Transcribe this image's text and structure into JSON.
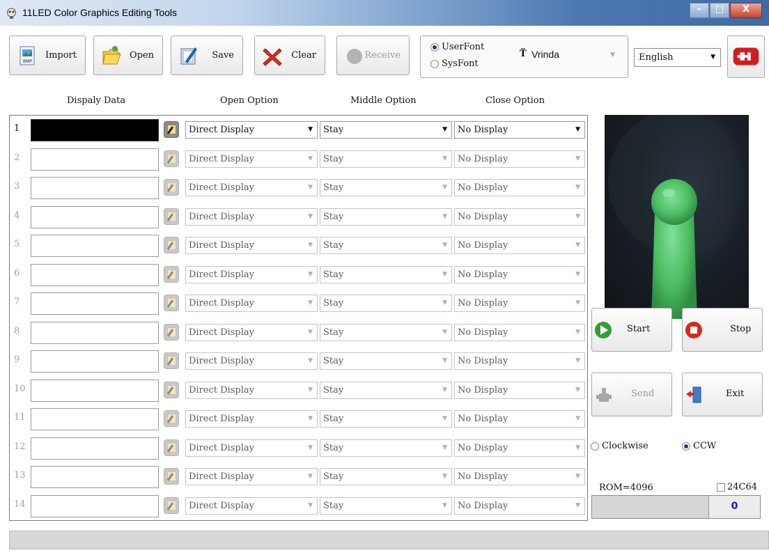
{
  "window": {
    "title": "11LED Color Graphics Editing Tools"
  },
  "toolbar": {
    "import_label": "Import",
    "open_label": "Open",
    "save_label": "Save",
    "clear_label": "Clear",
    "receive_label": "Receive"
  },
  "font": {
    "userfont_label": "UserFont",
    "sysfont_label": "SysFont",
    "selected_font": "Vrinda",
    "font_icon": "T̈"
  },
  "language": {
    "selected": "English"
  },
  "headers": {
    "display": "Dispaly Data",
    "open": "Open Option",
    "middle": "Middle Option",
    "close": "Close Option"
  },
  "rows": [
    {
      "num": "1",
      "open": "Direct Display",
      "middle": "Stay",
      "close": "No Display"
    },
    {
      "num": "2",
      "open": "Direct Display",
      "middle": "Stay",
      "close": "No Display"
    },
    {
      "num": "3",
      "open": "Direct Display",
      "middle": "Stay",
      "close": "No Display"
    },
    {
      "num": "4",
      "open": "Direct Display",
      "middle": "Stay",
      "close": "No Display"
    },
    {
      "num": "5",
      "open": "Direct Display",
      "middle": "Stay",
      "close": "No Display"
    },
    {
      "num": "6",
      "open": "Direct Display",
      "middle": "Stay",
      "close": "No Display"
    },
    {
      "num": "7",
      "open": "Direct Display",
      "middle": "Stay",
      "close": "No Display"
    },
    {
      "num": "8",
      "open": "Direct Display",
      "middle": "Stay",
      "close": "No Display"
    },
    {
      "num": "9",
      "open": "Direct Display",
      "middle": "Stay",
      "close": "No Display"
    },
    {
      "num": "10",
      "open": "Direct Display",
      "middle": "Stay",
      "close": "No Display"
    },
    {
      "num": "11",
      "open": "Direct Display",
      "middle": "Stay",
      "close": "No Display"
    },
    {
      "num": "12",
      "open": "Direct Display",
      "middle": "Stay",
      "close": "No Display"
    },
    {
      "num": "13",
      "open": "Direct Display",
      "middle": "Stay",
      "close": "No Display"
    },
    {
      "num": "14",
      "open": "Direct Display",
      "middle": "Stay",
      "close": "No Display"
    }
  ],
  "controls": {
    "start_label": "Start",
    "stop_label": "Stop",
    "send_label": "Send",
    "exit_label": "Exit",
    "clockwise_label": "Clockwise",
    "ccw_label": "CCW",
    "rom_label": "ROM=4096",
    "chip_label": "24C64",
    "progress_value": "0"
  },
  "colors": {
    "accent": "#1f3f7a",
    "start_green": "#3a9a3a",
    "stop_red": "#d8281c",
    "preview_object_green": "#57c46a"
  }
}
